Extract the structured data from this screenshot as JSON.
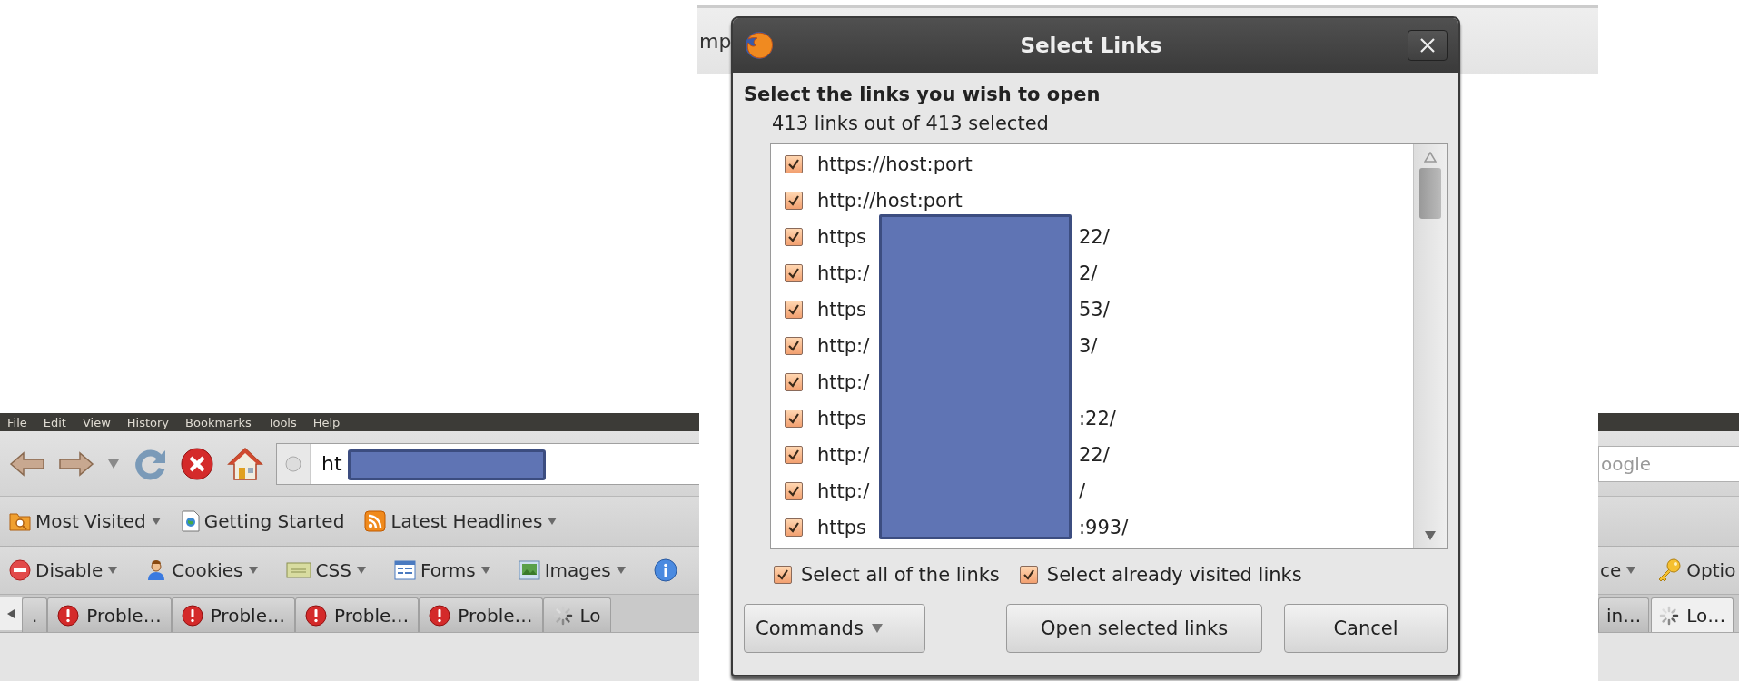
{
  "browser_left": {
    "menu": [
      "File",
      "Edit",
      "View",
      "History",
      "Bookmarks",
      "Tools",
      "Help"
    ],
    "address": {
      "value": "ht"
    },
    "bookmarks": [
      {
        "label": "Most Visited",
        "kind": "folder",
        "dropdown": true
      },
      {
        "label": "Getting Started",
        "kind": "page"
      },
      {
        "label": "Latest Headlines",
        "kind": "feed",
        "dropdown": true
      }
    ],
    "dev_toolbar": [
      {
        "label": "Disable",
        "kind": "disable",
        "dropdown": true
      },
      {
        "label": "Cookies",
        "kind": "cookies",
        "dropdown": true
      },
      {
        "label": "CSS",
        "kind": "css",
        "dropdown": true
      },
      {
        "label": "Forms",
        "kind": "forms",
        "dropdown": true
      },
      {
        "label": "Images",
        "kind": "images",
        "dropdown": true
      },
      {
        "kind": "info"
      }
    ],
    "tabs": [
      {
        "label": ".",
        "kind": "plain",
        "selected": false
      },
      {
        "label": "Proble…",
        "kind": "error",
        "selected": false
      },
      {
        "label": "Proble…",
        "kind": "error",
        "selected": false
      },
      {
        "label": "Proble…",
        "kind": "error",
        "selected": false
      },
      {
        "label": "Proble…",
        "kind": "error",
        "selected": false
      },
      {
        "label": "Lo",
        "kind": "loading",
        "selected": false
      }
    ]
  },
  "top_strip": {
    "text": "mp"
  },
  "browser_right": {
    "search": {
      "placeholder": "oogle"
    },
    "dev_toolbar": [
      {
        "label": "ce",
        "kind": "none",
        "dropdown": true
      },
      {
        "label": "Optio",
        "kind": "options"
      }
    ],
    "tabs": [
      {
        "label": "in…",
        "kind": "plain",
        "selected": false
      },
      {
        "label": "Lo…",
        "kind": "loading",
        "selected": true
      }
    ]
  },
  "dialog": {
    "title": "Select Links",
    "heading": "Select the links you wish to open",
    "count": "413 links out of 413 selected",
    "links": [
      {
        "text": "https://host:port",
        "checked": true
      },
      {
        "text": "http://host:port",
        "checked": true
      },
      {
        "text": "https",
        "tail": "22/",
        "checked": true
      },
      {
        "text": "http:/",
        "tail": "2/",
        "checked": true
      },
      {
        "text": "https",
        "tail": "53/",
        "checked": true
      },
      {
        "text": "http:/",
        "tail": "3/",
        "checked": true
      },
      {
        "text": "http:/",
        "checked": true
      },
      {
        "text": "https",
        "tail": ":22/",
        "checked": true
      },
      {
        "text": "http:/",
        "tail": "22/",
        "checked": true
      },
      {
        "text": "http:/",
        "tail": "/",
        "checked": true
      },
      {
        "text": "https",
        "tail": ":993/",
        "checked": true
      }
    ],
    "options": [
      {
        "label": "Select all of the links",
        "checked": true
      },
      {
        "label": "Select already visited links",
        "checked": true
      }
    ],
    "buttons": [
      {
        "label": "Commands",
        "kind": "menu"
      },
      {
        "label": "Open selected links",
        "kind": "push"
      },
      {
        "label": "Cancel",
        "kind": "push"
      }
    ]
  }
}
